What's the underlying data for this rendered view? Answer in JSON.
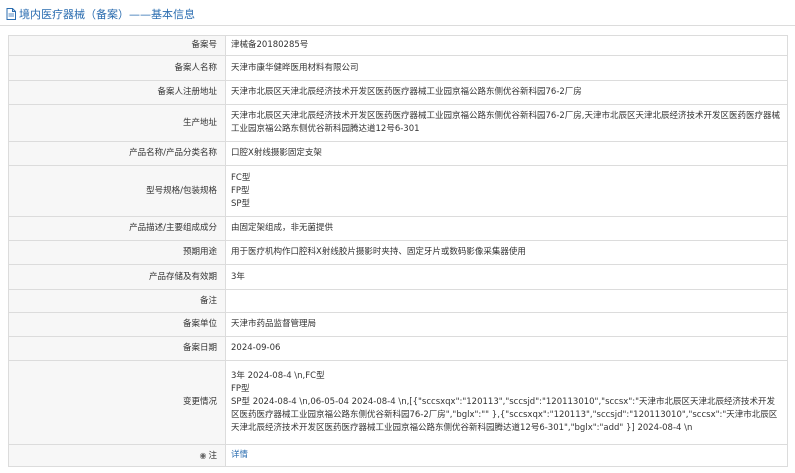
{
  "header": {
    "title": "境内医疗器械（备案）——基本信息"
  },
  "rows": [
    {
      "label": "备案号",
      "value": "津械备20180285号"
    },
    {
      "label": "备案人名称",
      "value": "天津市康华健晔医用材料有限公司"
    },
    {
      "label": "备案人注册地址",
      "value": "天津市北辰区天津北辰经济技术开发区医药医疗器械工业园京福公路东侧优谷新科园76-2厂房"
    },
    {
      "label": "生产地址",
      "value": "天津市北辰区天津北辰经济技术开发区医药医疗器械工业园京福公路东侧优谷新科园76-2厂房,天津市北辰区天津北辰经济技术开发区医药医疗器械工业园京福公路东侧优谷新科园腾达道12号6-301"
    },
    {
      "label": "产品名称/产品分类名称",
      "value": "口腔X射线摄影固定支架"
    },
    {
      "label": "型号规格/包装规格",
      "lines": [
        "FC型",
        "FP型",
        "SP型"
      ]
    },
    {
      "label": "产品描述/主要组成成分",
      "value": "由固定架组成，非无菌提供"
    },
    {
      "label": "预期用途",
      "value": "用于医疗机构作口腔科X射线胶片摄影时夹持、固定牙片或数码影像采集器使用"
    },
    {
      "label": "产品存储及有效期",
      "value": "3年"
    },
    {
      "label": "备注",
      "value": ""
    },
    {
      "label": "备案单位",
      "value": "天津市药品监督管理局"
    },
    {
      "label": "备案日期",
      "value": "2024-09-06"
    },
    {
      "label": "变更情况",
      "lines": [
        "3年 2024-08-4 \\n,FC型",
        "FP型"
      ],
      "rest": "SP型 2024-08-4 \\n,06-05-04 2024-08-4 \\n,[{\"sccsxqx\":\"120113\",\"sccsjd\":\"120113010\",\"sccsx\":\"天津市北辰区天津北辰经济技术开发区医药医疗器械工业园京福公路东侧优谷新科园76-2厂房\",\"bglx\":\"\" },{\"sccsxqx\":\"120113\",\"sccsjd\":\"120113010\",\"sccsx\":\"天津市北辰区天津北辰经济技术开发区医药医疗器械工业园京福公路东侧优谷新科园腾达道12号6-301\",\"bglx\":\"add\" }] 2024-08-4 \\n"
    },
    {
      "label": "注",
      "link": "详情"
    }
  ]
}
